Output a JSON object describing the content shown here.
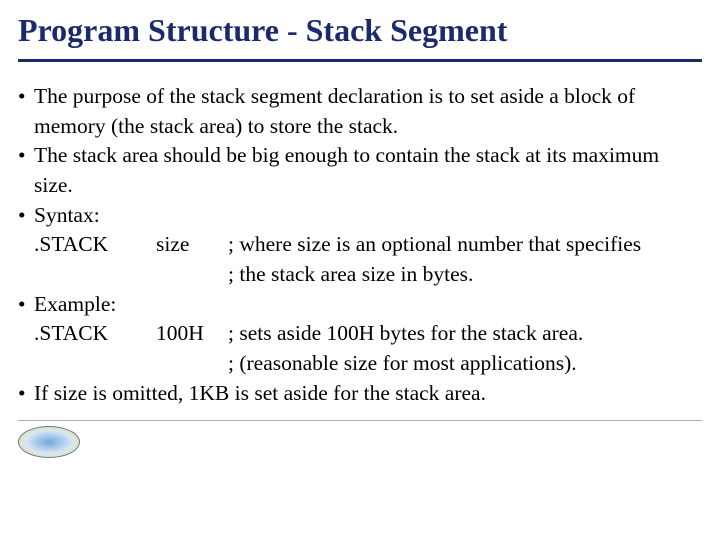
{
  "title": "Program Structure - Stack Segment",
  "bullets": {
    "b1": "The purpose of the stack segment declaration is to set aside a block of memory (the stack area) to store the stack.",
    "b2": "The stack area should be big enough to contain the stack at its maximum size.",
    "b3": "Syntax:",
    "b4": "Example:",
    "b5": "If size is omitted, 1KB is set aside for the stack area."
  },
  "syntax": {
    "directive": ".STACK",
    "arg": "size",
    "c1": "; where size is an optional number that specifies",
    "c2": "; the stack area size in  bytes."
  },
  "example": {
    "directive": ".STACK",
    "arg": "100H",
    "c1": "; sets aside 100H bytes for the stack area.",
    "c2": "; (reasonable size for most applications)."
  }
}
